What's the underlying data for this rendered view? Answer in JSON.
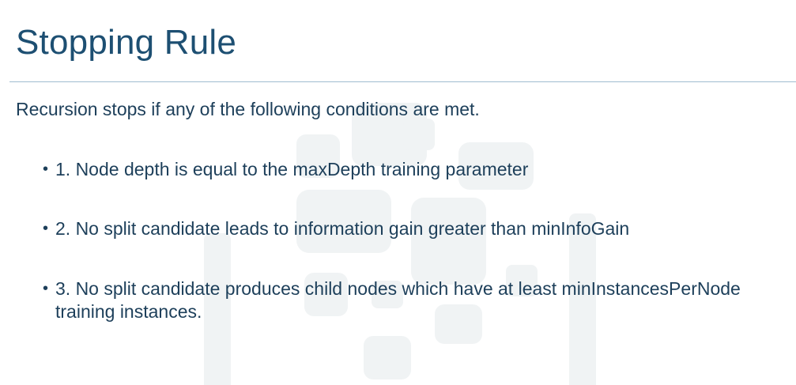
{
  "slide": {
    "title": "Stopping Rule",
    "intro": "Recursion stops if any of the following conditions are met.",
    "bullet_glyph": "•",
    "conditions": [
      {
        "text": "1. Node depth is equal to the maxDepth training parameter"
      },
      {
        "text": "2. No split candidate leads to information gain greater than minInfoGain"
      },
      {
        "text": "3. No split candidate produces child nodes which have at least minInstancesPerNode training instances."
      }
    ]
  },
  "colors": {
    "title": "#1d4f72",
    "body_text": "#1d3f5a",
    "rule": "#9fbcd0",
    "watermark": "#1d3f5a"
  },
  "icons": {
    "watermark": "logo-watermark-icon"
  }
}
